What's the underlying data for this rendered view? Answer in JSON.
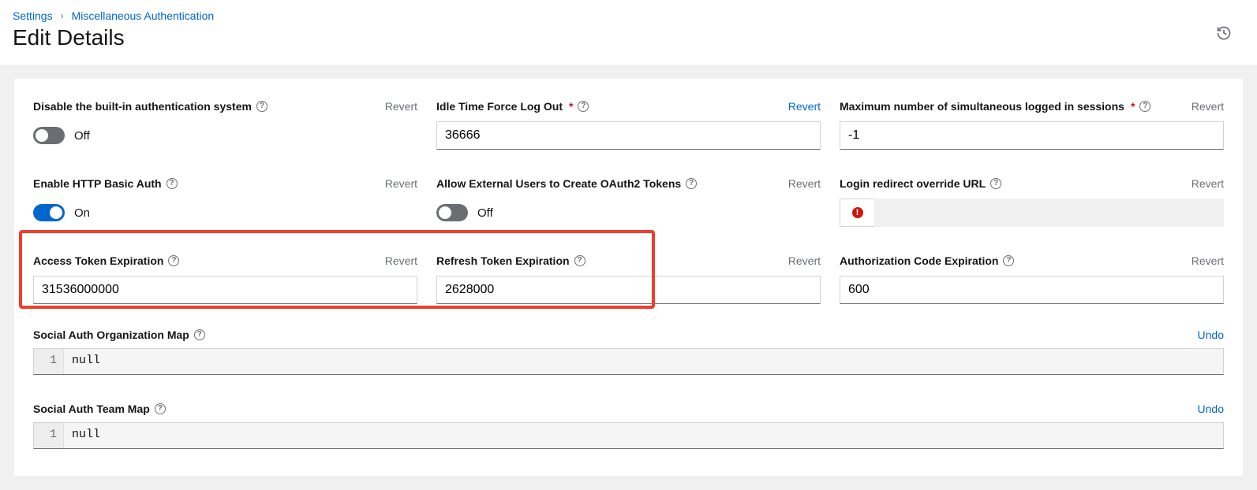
{
  "breadcrumb": {
    "settings": "Settings",
    "misc": "Miscellaneous Authentication"
  },
  "page": {
    "title": "Edit Details"
  },
  "labels": {
    "revert": "Revert",
    "undo": "Undo",
    "on": "On",
    "off": "Off",
    "gutter1": "1"
  },
  "fields": {
    "disable_auth": {
      "label": "Disable the built-in authentication system",
      "state": "Off"
    },
    "idle_time": {
      "label": "Idle Time Force Log Out",
      "value": "36666",
      "revert_active": true
    },
    "max_sessions": {
      "label": "Maximum number of simultaneous logged in sessions",
      "value": "-1"
    },
    "http_basic": {
      "label": "Enable HTTP Basic Auth",
      "state": "On"
    },
    "allow_external": {
      "label": "Allow External Users to Create OAuth2 Tokens",
      "state": "Off"
    },
    "login_redirect": {
      "label": "Login redirect override URL"
    },
    "access_token": {
      "label": "Access Token Expiration",
      "value": "31536000000"
    },
    "refresh_token": {
      "label": "Refresh Token Expiration",
      "value": "2628000"
    },
    "auth_code": {
      "label": "Authorization Code Expiration",
      "value": "600"
    },
    "org_map": {
      "label": "Social Auth Organization Map",
      "code": "null"
    },
    "team_map": {
      "label": "Social Auth Team Map",
      "code": "null"
    }
  }
}
